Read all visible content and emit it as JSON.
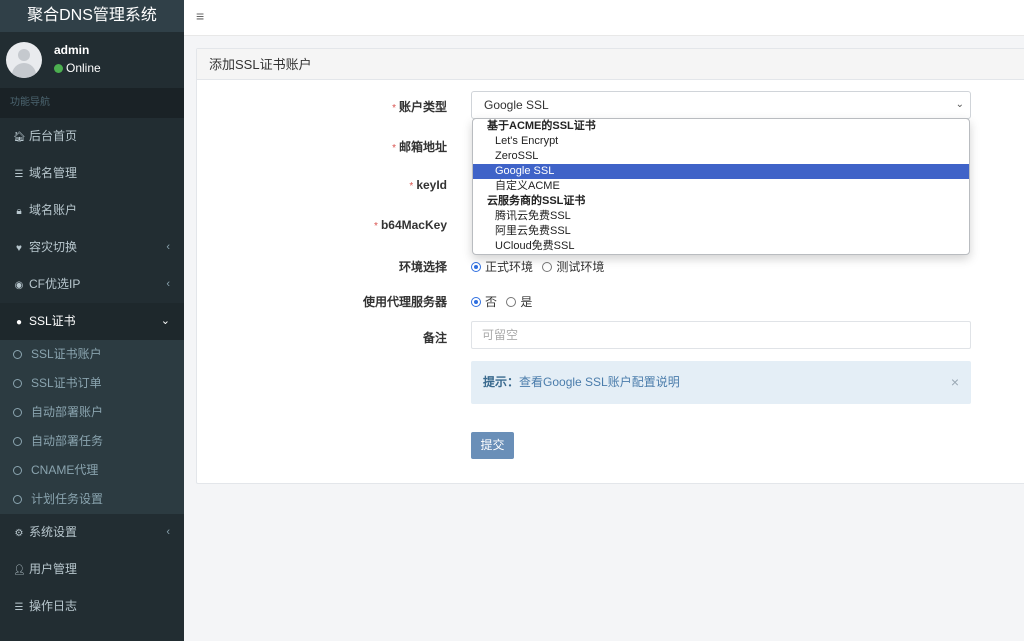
{
  "app": {
    "title": "聚合DNS管理系统"
  },
  "user": {
    "name": "admin",
    "status": "Online"
  },
  "sidebar": {
    "nav_header": "功能导航",
    "items": [
      {
        "label": "后台首页",
        "icon": "home-icon"
      },
      {
        "label": "域名管理",
        "icon": "list-icon"
      },
      {
        "label": "域名账户",
        "icon": "lock-icon"
      },
      {
        "label": "容灾切换",
        "icon": "heartbeat-icon"
      },
      {
        "label": "CF优选IP",
        "icon": "globe-icon"
      },
      {
        "label": "SSL证书",
        "icon": "ssl-icon"
      },
      {
        "label": "系统设置",
        "icon": "gears-icon"
      },
      {
        "label": "用户管理",
        "icon": "user-icon"
      },
      {
        "label": "操作日志",
        "icon": "list-icon"
      }
    ],
    "ssl_submenu": [
      "SSL证书账户",
      "SSL证书订单",
      "自动部署账户",
      "自动部署任务",
      "CNAME代理",
      "计划任务设置"
    ]
  },
  "panel": {
    "title": "添加SSL证书账户"
  },
  "form": {
    "account_type_label": "账户类型",
    "account_type_value": "Google SSL",
    "email_label": "邮箱地址",
    "keyid_label": "keyId",
    "b64mackey_label": "b64MacKey",
    "env_label": "环境选择",
    "env_options": [
      "正式环境",
      "测试环境"
    ],
    "proxy_label": "使用代理服务器",
    "proxy_options": [
      "否",
      "是"
    ],
    "remark_label": "备注",
    "remark_placeholder": "可留空",
    "hint_prefix": "提示：",
    "hint_link": "查看Google SSL账户配置说明",
    "submit_label": "提交"
  },
  "dropdown": {
    "groups": [
      {
        "label": "基于ACME的SSL证书",
        "options": [
          "Let's Encrypt",
          "ZeroSSL",
          "Google SSL",
          "自定义ACME"
        ]
      },
      {
        "label": "云服务商的SSL证书",
        "options": [
          "腾讯云免费SSL",
          "阿里云免费SSL",
          "UCloud免费SSL"
        ]
      }
    ],
    "selected": "Google SSL"
  },
  "colors": {
    "sidebar_bg": "#222d32",
    "selected_option": "#3f63c8",
    "submit_button": "#6a8fb8"
  }
}
